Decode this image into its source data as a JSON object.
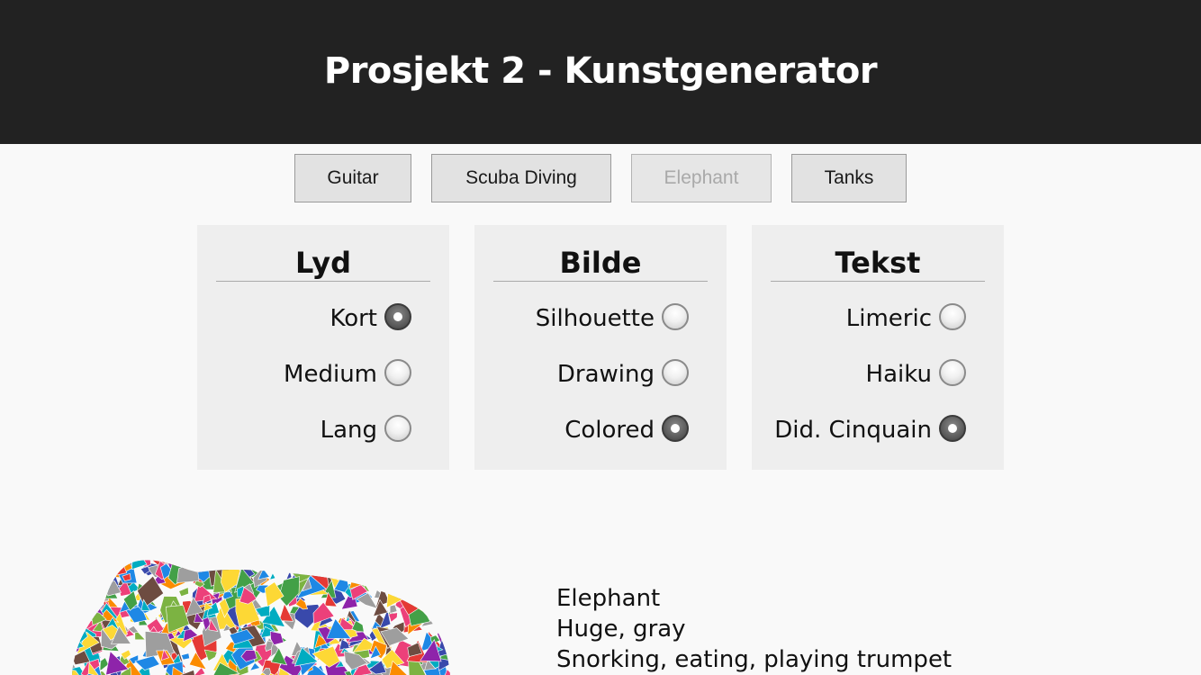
{
  "header": {
    "title": "Prosjekt 2 - Kunstgenerator",
    "background": "#222222"
  },
  "categories": [
    {
      "label": "Guitar",
      "disabled": false
    },
    {
      "label": "Scuba Diving",
      "disabled": false
    },
    {
      "label": "Elephant",
      "disabled": true
    },
    {
      "label": "Tanks",
      "disabled": false
    }
  ],
  "panels": {
    "lyd": {
      "title": "Lyd",
      "options": [
        {
          "label": "Kort",
          "checked": true
        },
        {
          "label": "Medium",
          "checked": false
        },
        {
          "label": "Lang",
          "checked": false
        }
      ]
    },
    "bilde": {
      "title": "Bilde",
      "options": [
        {
          "label": "Silhouette",
          "checked": false
        },
        {
          "label": "Drawing",
          "checked": false
        },
        {
          "label": "Colored",
          "checked": true
        }
      ]
    },
    "tekst": {
      "title": "Tekst",
      "options": [
        {
          "label": "Limeric",
          "checked": false
        },
        {
          "label": "Haiku",
          "checked": false
        },
        {
          "label": "Did. Cinquain",
          "checked": true
        }
      ]
    }
  },
  "poem": {
    "lines": [
      "Elephant",
      "Huge, gray",
      "Snorking, eating, playing trumpet"
    ]
  },
  "artwork": {
    "icon": "elephant-mosaic-icon",
    "palette": [
      "#e53935",
      "#1e88e5",
      "#43a047",
      "#fdd835",
      "#8e24aa",
      "#fb8c00",
      "#00acc1",
      "#ec407a",
      "#6d4c41",
      "#9e9e9e",
      "#7cb342",
      "#3949ab"
    ]
  }
}
